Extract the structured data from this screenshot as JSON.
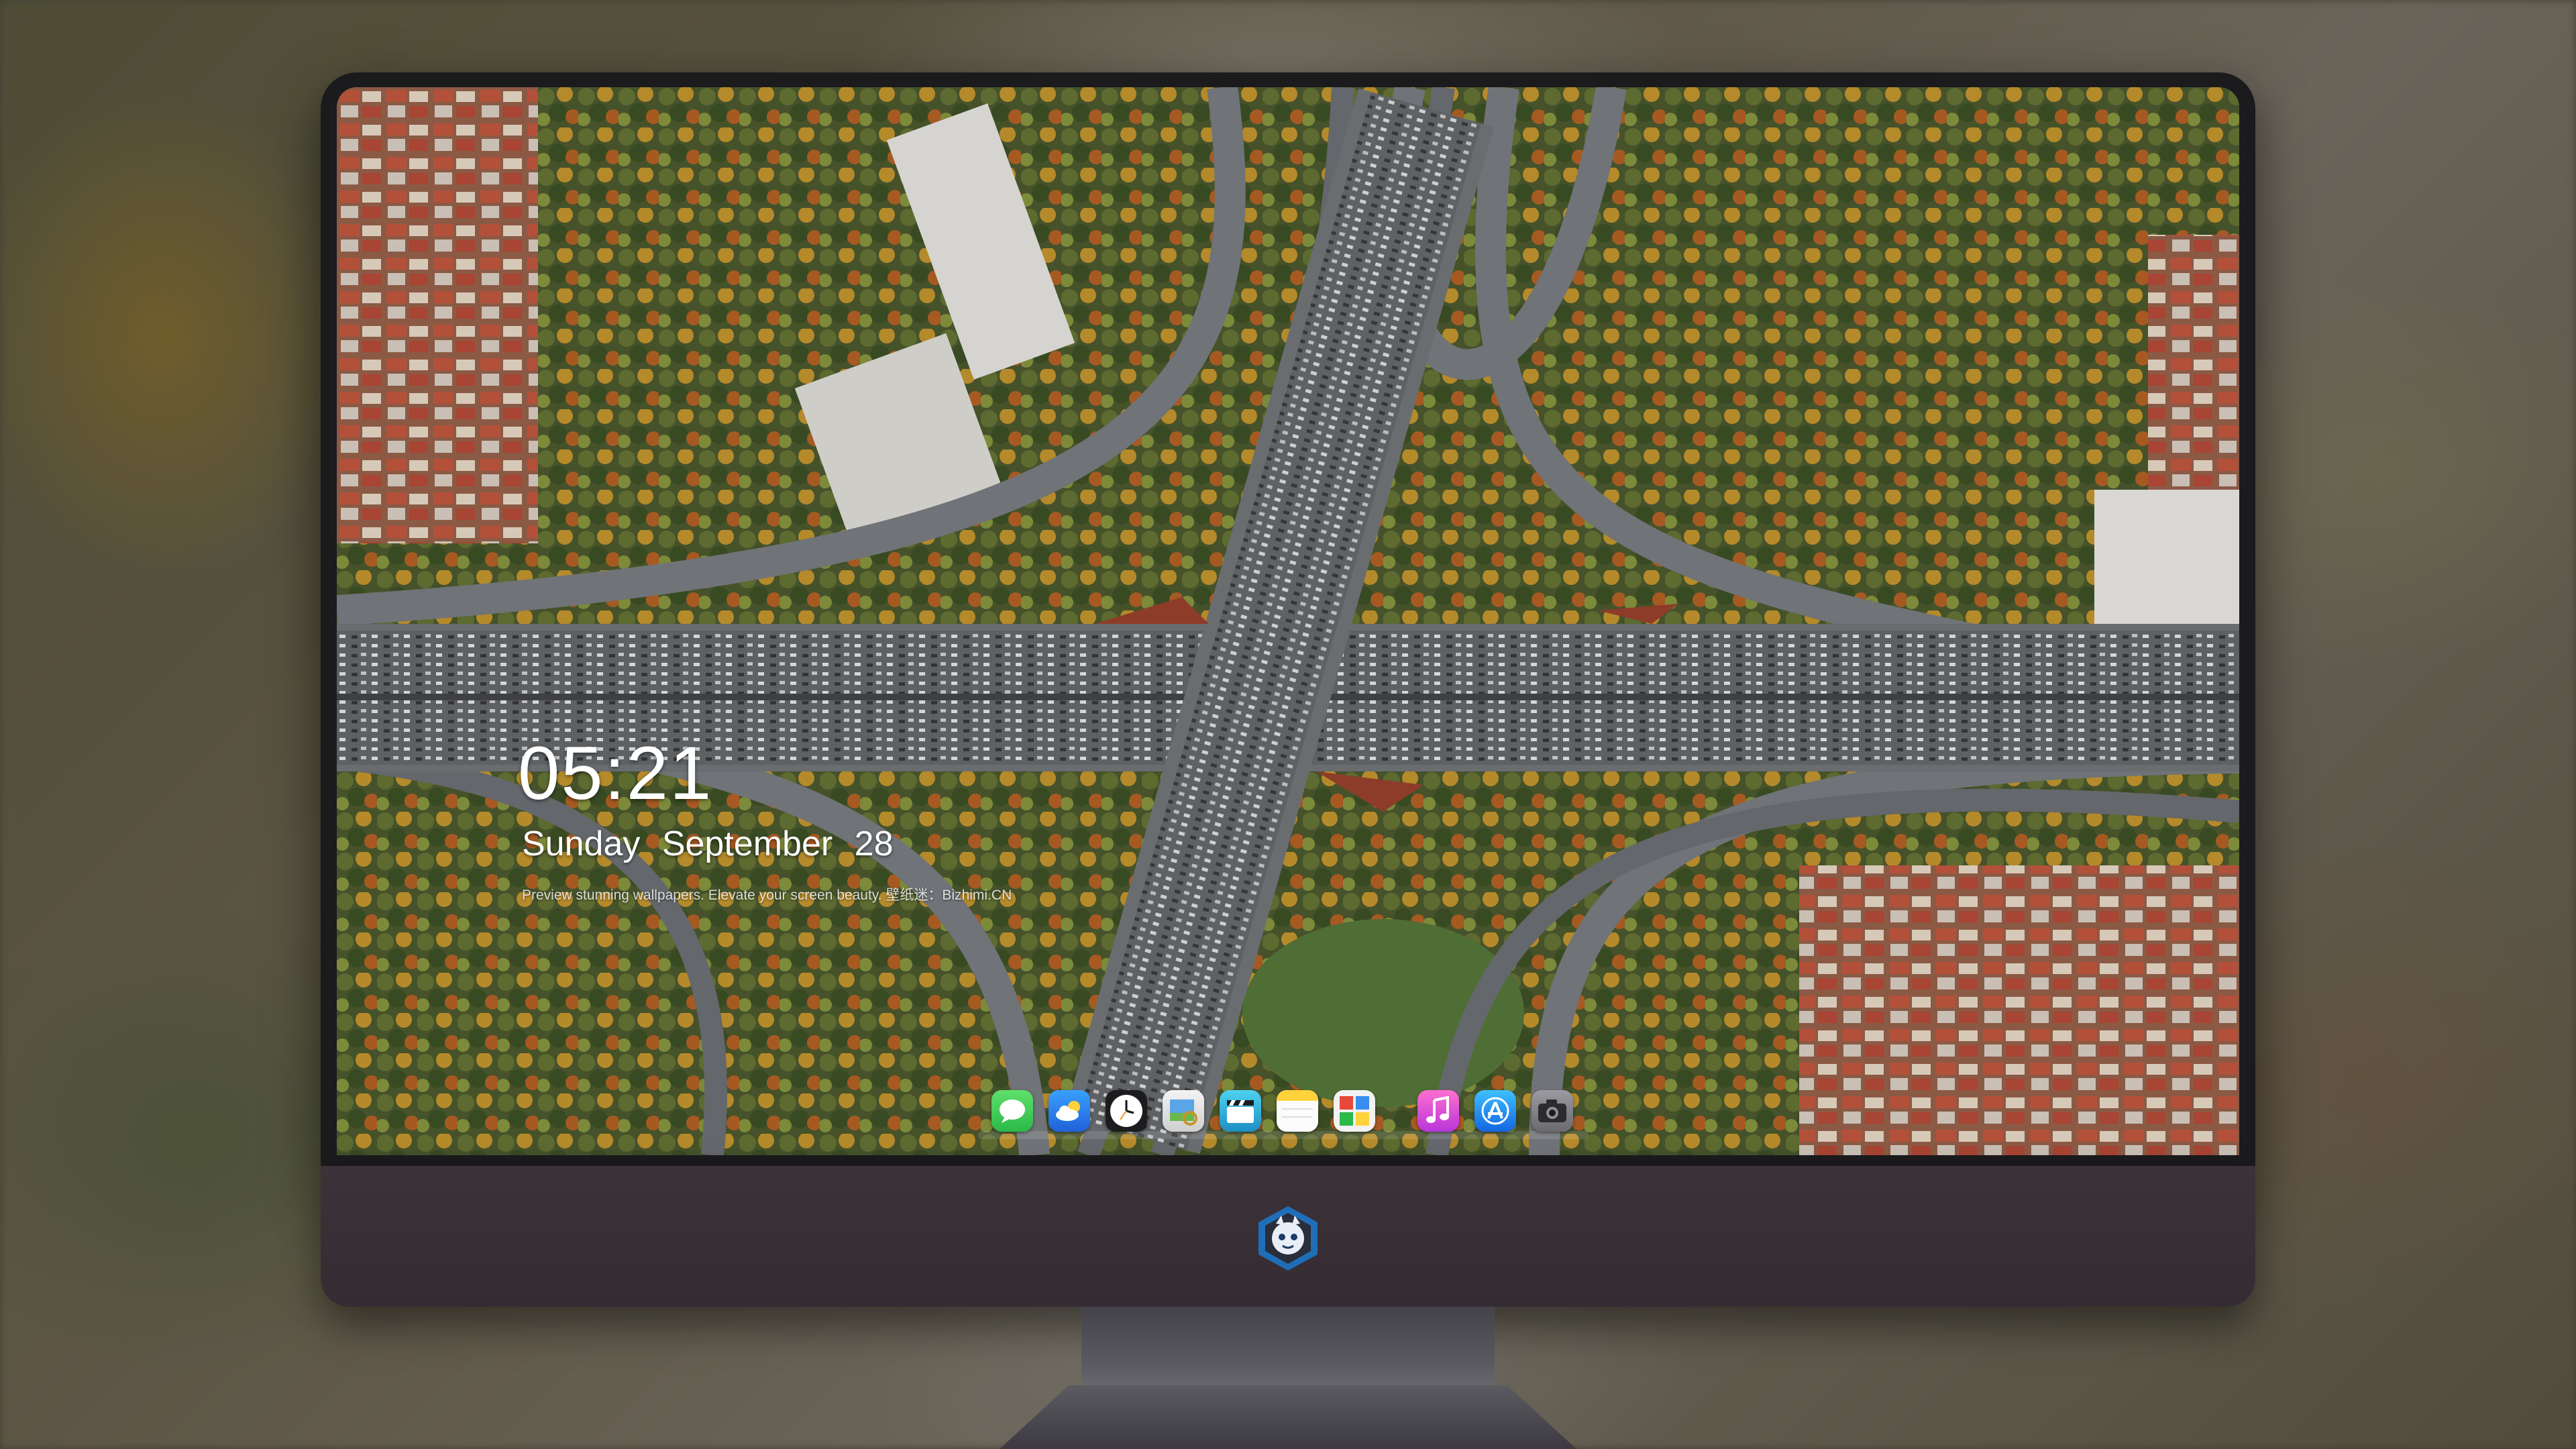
{
  "clock": {
    "time": "05:21"
  },
  "date": {
    "weekday": "Sunday",
    "month": "September",
    "day": "28"
  },
  "tagline": "Preview stunning wallpapers. Elevate your screen beauty. 壁纸迷：Bizhimi.CN",
  "dock": {
    "items": [
      {
        "name": "messages",
        "icon": "message-bubble-icon",
        "color": "#35c759"
      },
      {
        "name": "weather",
        "icon": "cloud-sun-icon",
        "color": "#3a8ef0"
      },
      {
        "name": "clock",
        "icon": "clock-icon",
        "color": "#ffffff"
      },
      {
        "name": "preview",
        "icon": "preview-icon",
        "color": "#e7b64a"
      },
      {
        "name": "clips",
        "icon": "clapperboard-icon",
        "color": "#3bb3d9"
      },
      {
        "name": "notes",
        "icon": "notes-icon",
        "color": "#ffd23c"
      },
      {
        "name": "photo-booth",
        "icon": "photo-grid-icon",
        "color": "#e6493a"
      },
      {
        "name": "music",
        "icon": "music-note-icon",
        "color": "#e14aa2"
      },
      {
        "name": "app-store",
        "icon": "app-store-icon",
        "color": "#1e8ff0"
      },
      {
        "name": "camera",
        "icon": "camera-icon",
        "color": "#8e8e93"
      }
    ]
  },
  "monitor": {
    "logo": "chibi-dragon-logo-icon"
  }
}
